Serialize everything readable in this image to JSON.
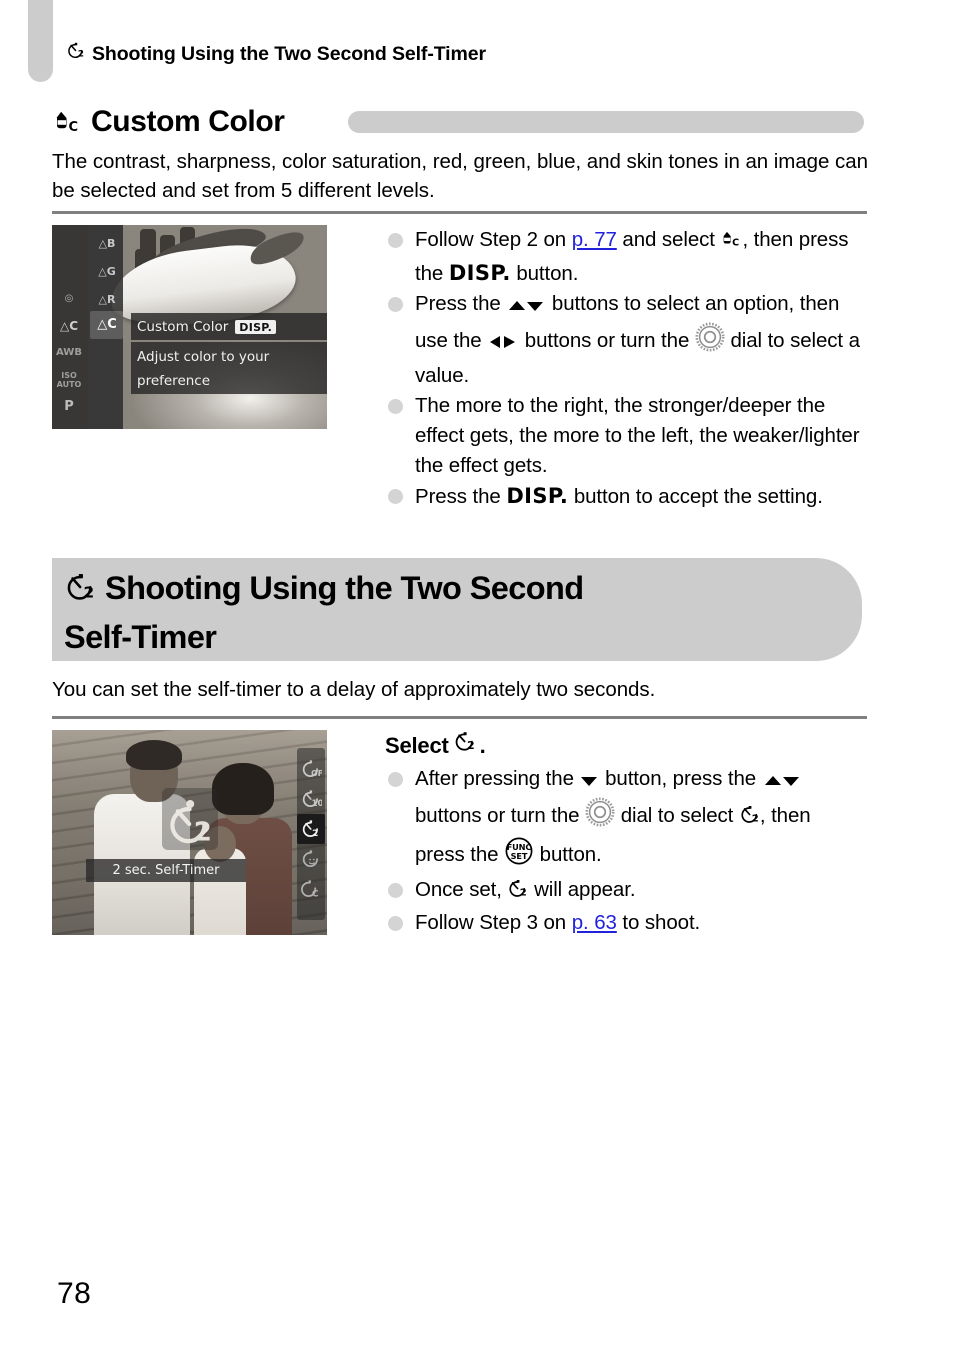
{
  "page": {
    "number": "78",
    "running_header": "Shooting Using the Two Second Self-Timer",
    "running_header_icon": "self-timer-2sec-icon"
  },
  "colors": {
    "band_gray": "#cccccc",
    "rule_gray": "#808080",
    "bullet_gray": "#d4d4d4",
    "page_reference_blue": "#2222dd"
  },
  "section_custom_color": {
    "icon": "custom-color-icon",
    "title": "Custom Color",
    "intro": "The contrast, sharpness, color saturation, red, green, blue, and skin tones in an image can be selected and set from 5 different levels.",
    "screenshot": {
      "name": "camera-lcd-custom-color",
      "menu_items": [
        "B",
        "G",
        "R",
        "C"
      ],
      "selected_item": "C",
      "left_icons": [
        "metering-icon",
        "custom-color-icon",
        "AWB",
        "ISO AUTO",
        "P"
      ],
      "label": "Custom Color",
      "label_chip": "DISP.",
      "description_line_1": "Adjust color to your",
      "description_line_2": "preference"
    },
    "bullets": [
      {
        "id": "bullet-follow-step-2",
        "parts": [
          {
            "t": "text",
            "v": "Follow Step 2 on "
          },
          {
            "t": "ref",
            "v": "p. 77"
          },
          {
            "t": "text",
            "v": " and select "
          },
          {
            "t": "icon",
            "v": "custom-color-icon"
          },
          {
            "t": "text",
            "v": " , then press the "
          },
          {
            "t": "disp",
            "v": "DISP."
          },
          {
            "t": "text",
            "v": " button."
          }
        ],
        "plain": "Follow Step 2 on p. 77 and select , then press the DISP. button."
      },
      {
        "id": "bullet-press-updown",
        "plain": "Press the ▲▼ buttons to select an option, then use the ◀▶ buttons or turn the ○ dial to select a value."
      },
      {
        "id": "bullet-more-to-right",
        "plain": "The more to the right, the stronger/deeper the effect gets, the more to the left, the weaker/lighter the effect gets."
      },
      {
        "id": "bullet-press-disp-accept",
        "plain": "Press the DISP. button to accept the setting."
      }
    ]
  },
  "section_self_timer": {
    "icon": "self-timer-2sec-icon",
    "title_line_1": "Shooting Using the Two Second",
    "title_line_2": "Self-Timer",
    "intro": "You can set the self-timer to a delay of approximately two seconds.",
    "screenshot": {
      "name": "camera-lcd-self-timer",
      "caption": "2 sec. Self-Timer",
      "rail_items": [
        "self-timer-off-icon",
        "self-timer-10sec-icon",
        "self-timer-2sec-icon",
        "self-timer-face-icon",
        "self-timer-custom-icon"
      ],
      "selected_rail_index": 2
    },
    "step_title": "Select",
    "step_title_icon": "self-timer-2sec-icon",
    "step_title_suffix": ".",
    "bullets": [
      {
        "id": "bullet-after-pressing-down",
        "plain": "After pressing the ▼ button, press the ▲▼ buttons or turn the ○ dial to select ⏱₂, then press the FUNC SET button."
      },
      {
        "id": "bullet-once-set",
        "plain": "Once set, ⏱₂ will appear."
      },
      {
        "id": "bullet-follow-step-3",
        "parts": [
          {
            "t": "text",
            "v": "Follow Step 3 on "
          },
          {
            "t": "ref",
            "v": "p. 63"
          },
          {
            "t": "text",
            "v": " to shoot."
          }
        ],
        "plain": "Follow Step 3 on p. 63 to shoot."
      }
    ]
  },
  "text_fragments": {
    "follow_step_2_pre": "Follow Step 2 on ",
    "p77": "p. 77",
    "follow_step_2_mid": " and select",
    "follow_step_2_then": ", then",
    "press_the": "press the",
    "disp": "DISP.",
    "button_period": "button.",
    "press_the_2": "Press the",
    "buttons_to_select": "buttons to select an option,",
    "then_use_the": "then use the",
    "buttons_or_turn_the": "buttons or turn the",
    "dial_to_select_value": "dial to select a value.",
    "more_right_l1": "The more to the right, the stronger/deeper",
    "more_right_l2": "the effect gets, the more to the left, the",
    "more_right_l3": "weaker/lighter the effect gets.",
    "press_disp_accept_l1": "Press the",
    "press_disp_accept_l2": "button to accept the",
    "press_disp_accept_l3": "setting.",
    "select_word": "Select",
    "period": ".",
    "after_pressing_the": "After pressing the",
    "button_press_the": "button, press the",
    "buttons_or_turn_the_2": "buttons or turn the",
    "dial_to_select": "dial to select",
    "comma_then_press_the": ", then press the",
    "button_period_2": "button.",
    "once_set": "Once set,",
    "will_appear": "will appear.",
    "follow_step_3_pre": "Follow Step 3 on ",
    "p63": "p. 63",
    "to_shoot": " to shoot."
  }
}
